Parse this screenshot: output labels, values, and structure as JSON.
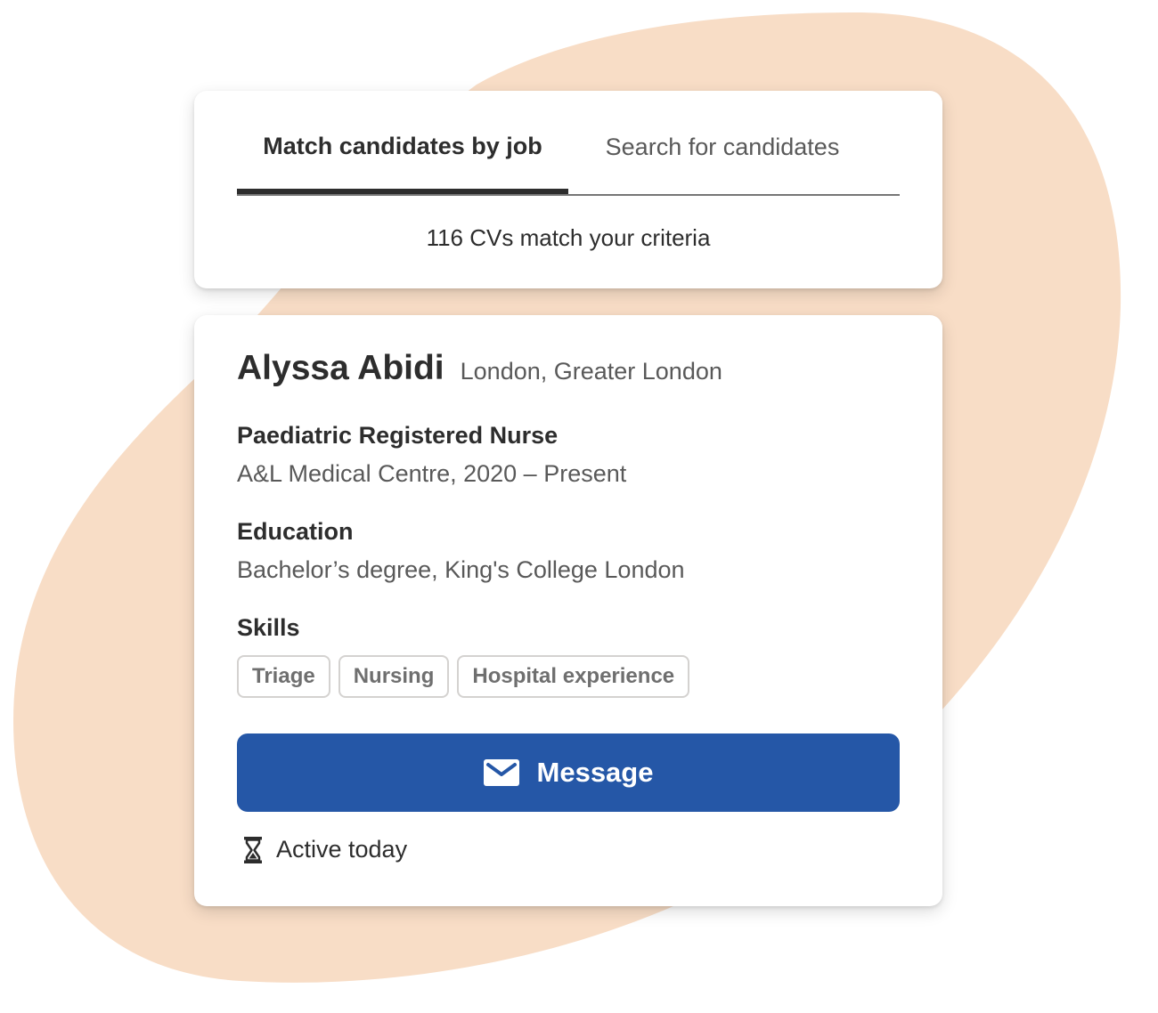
{
  "theme": {
    "background_blob": "#f8ddc6",
    "primary_button": "#2557a7",
    "text_primary": "#2d2d2d",
    "text_secondary": "#595959"
  },
  "search_card": {
    "tabs": [
      {
        "label": "Match candidates by job",
        "active": true
      },
      {
        "label": "Search for candidates",
        "active": false
      }
    ],
    "match_count_text": "116 CVs match your criteria"
  },
  "candidate": {
    "name": "Alyssa Abidi",
    "location": "London, Greater London",
    "job_title": "Paediatric Registered Nurse",
    "job_detail": "A&L Medical Centre, 2020 – Present",
    "education_title": "Education",
    "education_detail": "Bachelor’s degree, King's College London",
    "skills_title": "Skills",
    "skills": [
      "Triage",
      "Nursing",
      "Hospital experience"
    ],
    "message_button": {
      "label": "Message",
      "icon": "mail-icon"
    },
    "activity": {
      "label": "Active today",
      "icon": "hourglass-icon"
    }
  }
}
